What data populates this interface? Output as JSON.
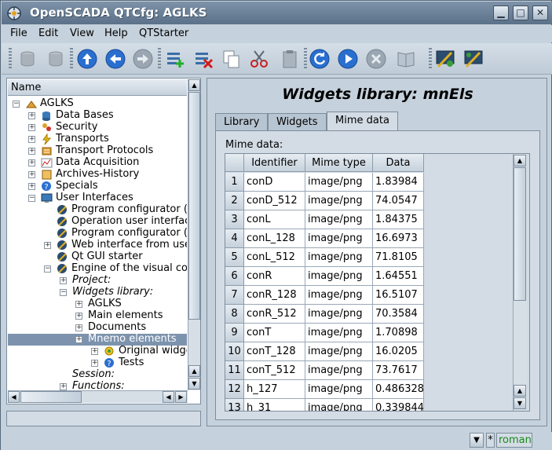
{
  "window": {
    "title": "OpenSCADA QTCfg: AGLKS"
  },
  "titlebar_buttons": [
    {
      "name": "minimize-button",
      "glyph": "▁"
    },
    {
      "name": "maximize-button",
      "glyph": "□"
    },
    {
      "name": "close-button",
      "glyph": "✕"
    }
  ],
  "menu": {
    "items": [
      "File",
      "Edit",
      "View",
      "Help",
      "QTStarter"
    ]
  },
  "toolbar": {
    "icons": [
      "db-load-icon",
      "db-save-icon",
      "up-icon",
      "back-icon",
      "forward-icon",
      "add-item-icon",
      "delete-item-icon",
      "copy-icon",
      "cut-icon",
      "paste-icon",
      "refresh-icon",
      "start-icon",
      "stop-icon",
      "manual-icon",
      "vision-icon",
      "qtcfg-icon"
    ]
  },
  "tree": {
    "header": "Name",
    "items": [
      {
        "label": "AGLKS",
        "level": 0,
        "expander": "−",
        "icon": "station-icon"
      },
      {
        "label": "Data Bases",
        "level": 1,
        "expander": "+",
        "icon": "database-icon"
      },
      {
        "label": "Security",
        "level": 1,
        "expander": "+",
        "icon": "security-icon"
      },
      {
        "label": "Transports",
        "level": 1,
        "expander": "+",
        "icon": "lightning-icon"
      },
      {
        "label": "Transport Protocols",
        "level": 1,
        "expander": "+",
        "icon": "protocol-icon"
      },
      {
        "label": "Data Acquisition",
        "level": 1,
        "expander": "+",
        "icon": "chart-icon"
      },
      {
        "label": "Archives-History",
        "level": 1,
        "expander": "+",
        "icon": "archive-icon"
      },
      {
        "label": "Specials",
        "level": 1,
        "expander": "+",
        "icon": "help-icon"
      },
      {
        "label": "User Interfaces",
        "level": 1,
        "expander": "−",
        "icon": "monitor-icon"
      },
      {
        "label": "Program configurator (",
        "level": 2,
        "expander": "",
        "icon": "tool-icon"
      },
      {
        "label": "Operation user interfac",
        "level": 2,
        "expander": "",
        "icon": "tool-icon"
      },
      {
        "label": "Program configurator (",
        "level": 2,
        "expander": "",
        "icon": "tool-icon"
      },
      {
        "label": "Web interface from use",
        "level": 2,
        "expander": "+",
        "icon": "tool-icon"
      },
      {
        "label": "Qt GUI starter",
        "level": 2,
        "expander": "",
        "icon": "tool-icon"
      },
      {
        "label": "Engine of the visual co",
        "level": 2,
        "expander": "−",
        "icon": "tool-icon"
      },
      {
        "label": "Project:",
        "level": 3,
        "expander": "+",
        "icon": "",
        "italic": true
      },
      {
        "label": "Widgets library:",
        "level": 3,
        "expander": "−",
        "icon": "",
        "italic": true
      },
      {
        "label": "AGLKS",
        "level": 4,
        "expander": "+",
        "icon": ""
      },
      {
        "label": "Main elements",
        "level": 4,
        "expander": "+",
        "icon": ""
      },
      {
        "label": "Documents",
        "level": 4,
        "expander": "+",
        "icon": ""
      },
      {
        "label": "Mnemo elements",
        "level": 4,
        "expander": "+",
        "icon": "",
        "selected": true
      },
      {
        "label": "Original widgets",
        "level": 5,
        "expander": "+",
        "icon": "widget-icon"
      },
      {
        "label": "Tests",
        "level": 5,
        "expander": "+",
        "icon": "help-icon"
      },
      {
        "label": "Session:",
        "level": 3,
        "expander": "",
        "icon": "",
        "italic": true
      },
      {
        "label": "Functions:",
        "level": 3,
        "expander": "+",
        "icon": "",
        "italic": true
      }
    ]
  },
  "main": {
    "title": "Widgets library: mnEls",
    "tabs": [
      {
        "label": "Library",
        "active": false
      },
      {
        "label": "Widgets",
        "active": false
      },
      {
        "label": "Mime data",
        "active": true
      }
    ],
    "mime_label": "Mime data:",
    "table": {
      "columns": [
        "Identifier",
        "Mime type",
        "Data"
      ],
      "rows": [
        {
          "n": "1",
          "id": "conD",
          "mime": "image/png",
          "data": "1.83984"
        },
        {
          "n": "2",
          "id": "conD_512",
          "mime": "image/png",
          "data": "74.0547"
        },
        {
          "n": "3",
          "id": "conL",
          "mime": "image/png",
          "data": "1.84375"
        },
        {
          "n": "4",
          "id": "conL_128",
          "mime": "image/png",
          "data": "16.6973"
        },
        {
          "n": "5",
          "id": "conL_512",
          "mime": "image/png",
          "data": "71.8105"
        },
        {
          "n": "6",
          "id": "conR",
          "mime": "image/png",
          "data": "1.64551"
        },
        {
          "n": "7",
          "id": "conR_128",
          "mime": "image/png",
          "data": "16.5107"
        },
        {
          "n": "8",
          "id": "conR_512",
          "mime": "image/png",
          "data": "70.3584"
        },
        {
          "n": "9",
          "id": "conT",
          "mime": "image/png",
          "data": "1.70898"
        },
        {
          "n": "10",
          "id": "conT_128",
          "mime": "image/png",
          "data": "16.0205"
        },
        {
          "n": "11",
          "id": "conT_512",
          "mime": "image/png",
          "data": "73.7617"
        },
        {
          "n": "12",
          "id": "h_127",
          "mime": "image/png",
          "data": "0.486328"
        },
        {
          "n": "13",
          "id": "h_31",
          "mime": "image/png",
          "data": "0.339844"
        }
      ]
    }
  },
  "statusbar": {
    "user": "roman",
    "menu_glyph": "▼",
    "modified": "*"
  }
}
